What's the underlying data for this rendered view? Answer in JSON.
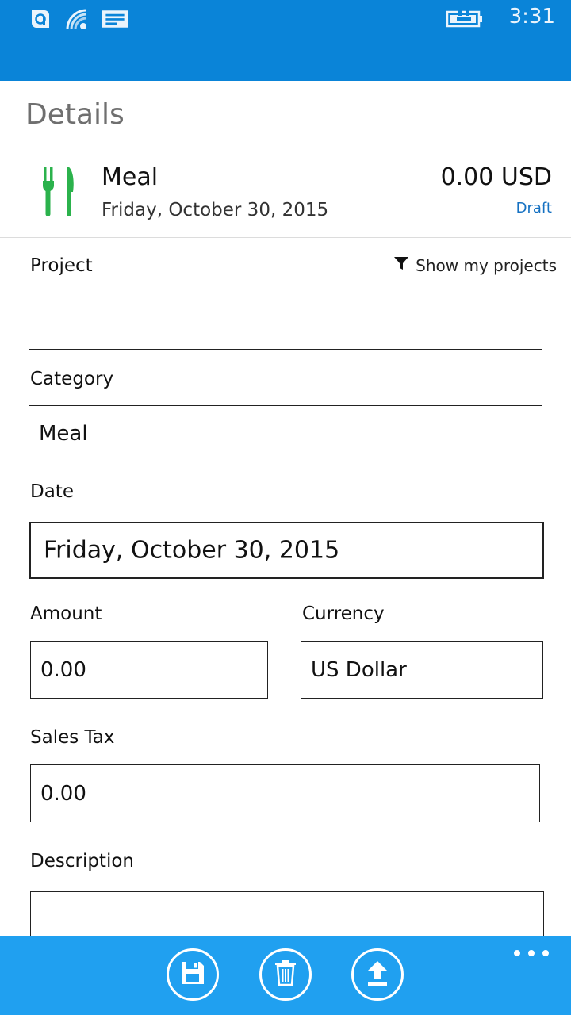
{
  "status_bar": {
    "time": "3:31",
    "icons": [
      "data-sense-icon",
      "wifi-icon",
      "message-icon",
      "battery-charging-icon"
    ]
  },
  "page": {
    "title": "Details"
  },
  "summary": {
    "title": "Meal",
    "date": "Friday, October 30, 2015",
    "amount": "0.00 USD",
    "status": "Draft",
    "icon": "fork-knife-icon",
    "icon_color": "#2bb24c"
  },
  "form": {
    "project": {
      "label": "Project",
      "value": "",
      "filter_label": "Show my projects"
    },
    "category": {
      "label": "Category",
      "value": "Meal"
    },
    "date": {
      "label": "Date",
      "value": "Friday, October 30, 2015"
    },
    "amount": {
      "label": "Amount",
      "value": "0.00"
    },
    "currency": {
      "label": "Currency",
      "value": "US Dollar"
    },
    "sales_tax": {
      "label": "Sales Tax",
      "value": "0.00"
    },
    "description": {
      "label": "Description",
      "value": ""
    }
  },
  "app_bar": {
    "buttons": [
      "save-icon",
      "delete-icon",
      "upload-icon"
    ],
    "more": "more-icon"
  },
  "colors": {
    "status_bar": "#0a84d8",
    "app_bar": "#20a0f0",
    "accent_link": "#1571c2"
  }
}
